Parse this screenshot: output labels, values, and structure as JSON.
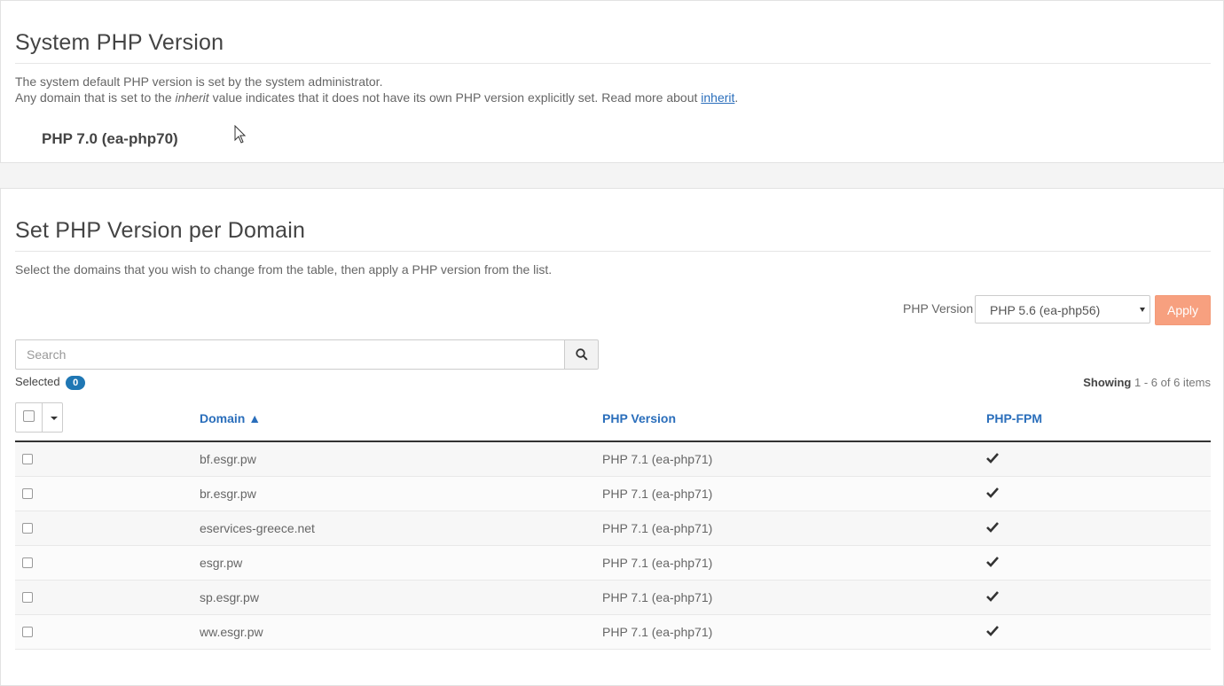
{
  "system": {
    "title": "System PHP Version",
    "desc_line1": "The system default PHP version is set by the system administrator.",
    "desc_line2_pre": "Any domain that is set to the ",
    "desc_line2_em": "inherit",
    "desc_line2_mid": " value indicates that it does not have its own PHP version explicitly set. Read more about ",
    "desc_line2_link": "inherit",
    "desc_line2_post": ".",
    "current_version": "PHP 7.0 (ea-php70)"
  },
  "domain_panel": {
    "title": "Set PHP Version per Domain",
    "description": "Select the domains that you wish to change from the table, then apply a PHP version from the list.",
    "php_version_label": "PHP Version",
    "selected_version": "PHP 5.6 (ea-php56)",
    "apply_label": "Apply",
    "search_placeholder": "Search",
    "selected_label": "Selected",
    "selected_count": "0",
    "showing_label": "Showing",
    "showing_range": "1 - 6 of 6 items"
  },
  "table": {
    "headers": {
      "domain": "Domain ▲",
      "php_version": "PHP Version",
      "php_fpm": "PHP-FPM"
    },
    "rows": [
      {
        "domain": "bf.esgr.pw",
        "php_version": "PHP 7.1 (ea-php71)",
        "fpm": true
      },
      {
        "domain": "br.esgr.pw",
        "php_version": "PHP 7.1 (ea-php71)",
        "fpm": true
      },
      {
        "domain": "eservices-greece.net",
        "php_version": "PHP 7.1 (ea-php71)",
        "fpm": true
      },
      {
        "domain": "esgr.pw",
        "php_version": "PHP 7.1 (ea-php71)",
        "fpm": true
      },
      {
        "domain": "sp.esgr.pw",
        "php_version": "PHP 7.1 (ea-php71)",
        "fpm": true
      },
      {
        "domain": "ww.esgr.pw",
        "php_version": "PHP 7.1 (ea-php71)",
        "fpm": true
      }
    ]
  },
  "colors": {
    "link": "#2a6ebb",
    "apply_button": "#f7a07f",
    "badge": "#1f77b4"
  },
  "icons": {
    "search": "search-icon",
    "check": "check-icon",
    "cursor": "mouse-cursor-icon"
  }
}
